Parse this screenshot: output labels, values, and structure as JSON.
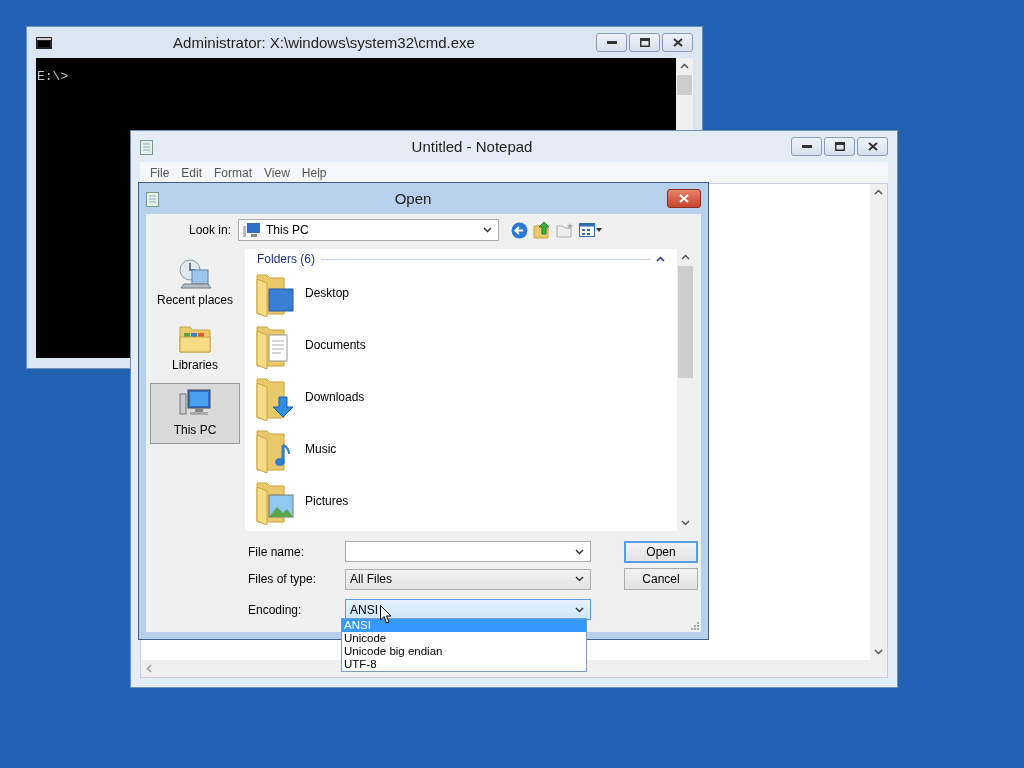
{
  "cmd_window": {
    "title": "Administrator: X:\\windows\\system32\\cmd.exe",
    "prompt": "E:\\>"
  },
  "notepad_window": {
    "title": "Untitled - Notepad",
    "menu": [
      "File",
      "Edit",
      "Format",
      "View",
      "Help"
    ]
  },
  "open_dialog": {
    "title": "Open",
    "look_in": {
      "label": "Look in:",
      "value": "This PC"
    },
    "places": [
      {
        "label": "Recent places",
        "kind": "recent",
        "selected": false
      },
      {
        "label": "Libraries",
        "kind": "libraries",
        "selected": false
      },
      {
        "label": "This PC",
        "kind": "pc",
        "selected": true
      }
    ],
    "folders_header": "Folders (6)",
    "folders": [
      {
        "name": "Desktop",
        "kind": "desktop"
      },
      {
        "name": "Documents",
        "kind": "documents"
      },
      {
        "name": "Downloads",
        "kind": "downloads"
      },
      {
        "name": "Music",
        "kind": "music"
      },
      {
        "name": "Pictures",
        "kind": "pictures"
      }
    ],
    "file_name": {
      "label": "File name:"
    },
    "files_of_type": {
      "label": "Files of type:",
      "value": "All Files"
    },
    "encoding": {
      "label": "Encoding:",
      "value": "ANSI",
      "expanded": true,
      "options": [
        {
          "label": "ANSI",
          "selected": true
        },
        {
          "label": "Unicode",
          "selected": false
        },
        {
          "label": "Unicode big endian",
          "selected": false
        },
        {
          "label": "UTF-8",
          "selected": false
        }
      ]
    },
    "buttons": [
      {
        "label": "Open",
        "kind": "default"
      },
      {
        "label": "Cancel",
        "kind": "normal"
      }
    ]
  }
}
